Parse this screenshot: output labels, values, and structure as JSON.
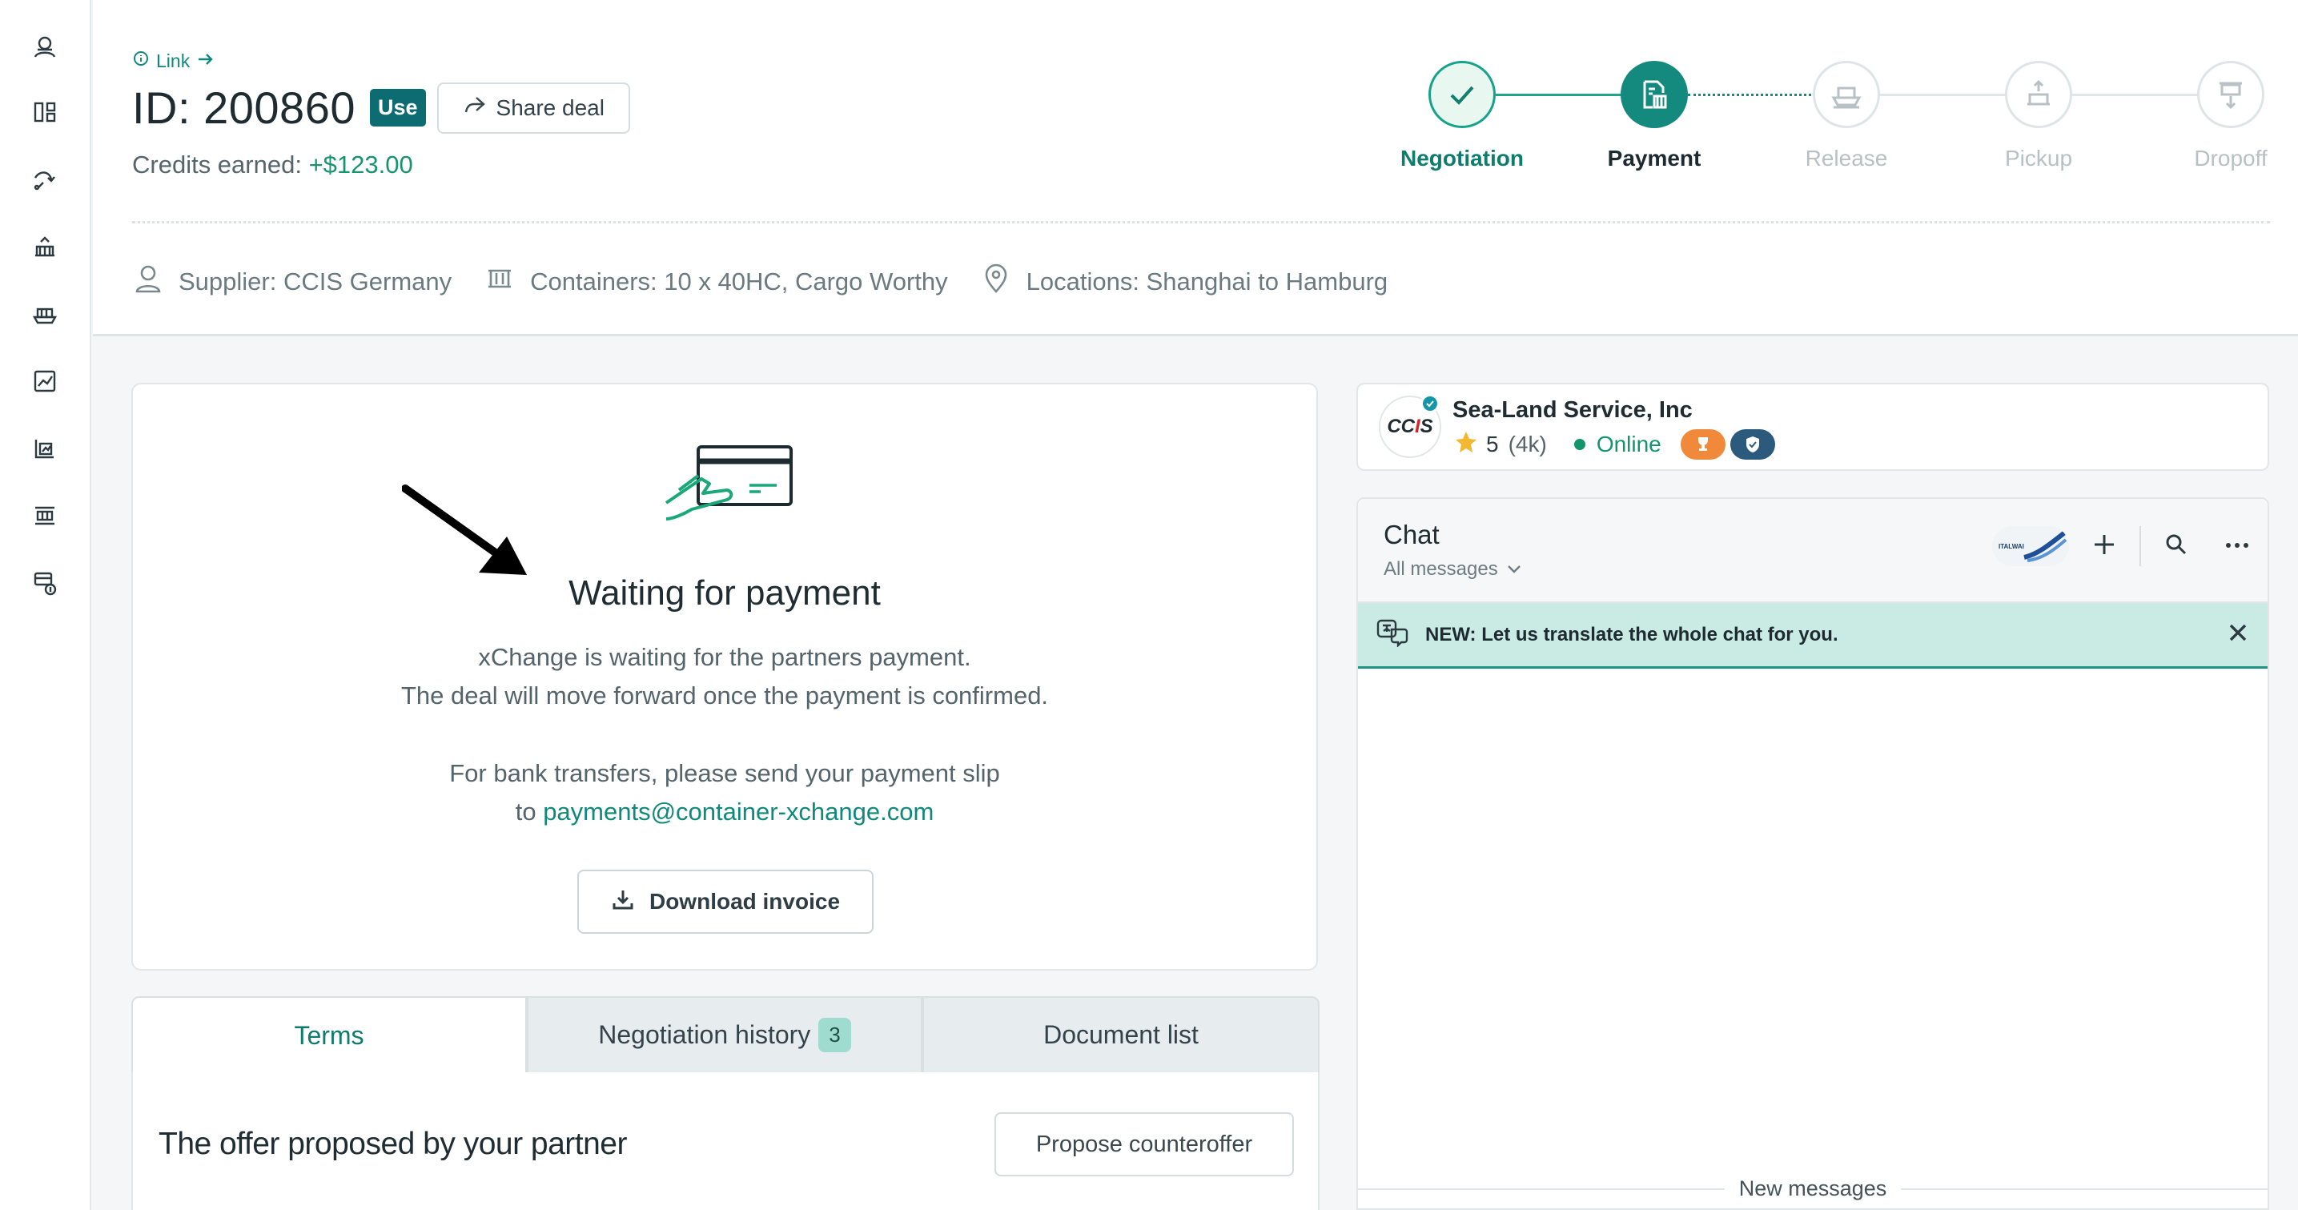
{
  "sidebar": {
    "icons": [
      "user-icon",
      "dashboard-icon",
      "routes-icon",
      "containers-icon",
      "ship-icon",
      "analytics-icon",
      "reports-icon",
      "inventory-icon",
      "billing-icon"
    ]
  },
  "header": {
    "link_label": "Link",
    "deal_id": "ID: 200860",
    "use_badge": "Use",
    "share_label": "Share deal",
    "credits_label": "Credits earned:",
    "credits_value": "+$123.00",
    "supplier": "Supplier: CCIS Germany",
    "containers": "Containers: 10 x 40HC, Cargo Worthy",
    "locations": "Locations: Shanghai to Hamburg"
  },
  "steps": [
    {
      "label": "Negotiation",
      "state": "done"
    },
    {
      "label": "Payment",
      "state": "active"
    },
    {
      "label": "Release",
      "state": "todo"
    },
    {
      "label": "Pickup",
      "state": "todo"
    },
    {
      "label": "Dropoff",
      "state": "todo"
    }
  ],
  "payment": {
    "title": "Waiting for payment",
    "line1": "xChange is waiting for the partners payment.",
    "line2": "The deal will move forward once the payment is confirmed.",
    "line3": "For bank transfers, please send your payment slip",
    "line4_prefix": "to",
    "email": "payments@container-xchange.com",
    "download_label": "Download invoice"
  },
  "tabs": [
    {
      "label": "Terms",
      "active": true
    },
    {
      "label": "Negotiation history",
      "count": "3"
    },
    {
      "label": "Document list"
    }
  ],
  "offer": {
    "title": "The offer proposed by your partner",
    "counter_label": "Propose counteroffer"
  },
  "partner": {
    "logo_text_dark": "CC",
    "logo_text_red": "I",
    "logo_text_dark2": "S",
    "name": "Sea-Land Service, Inc",
    "rating": "5",
    "reviews": "(4k)",
    "status": "Online"
  },
  "chat": {
    "title": "Chat",
    "filter": "All messages",
    "avatar_text": "ITALWAI",
    "translate_notice": "NEW: Let us translate the whole chat for you.",
    "new_messages": "New messages"
  },
  "colors": {
    "accent": "#0f8a7a",
    "active_step": "#148a7e",
    "credits": "#17936f",
    "translate_bg": "#c9ebe4"
  }
}
